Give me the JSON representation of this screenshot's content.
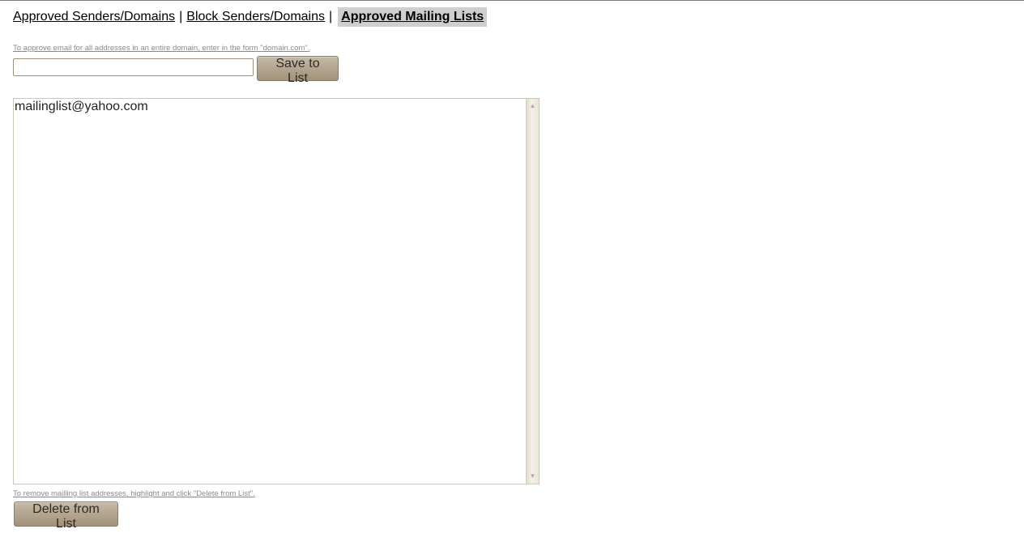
{
  "nav": {
    "approved_senders": "Approved Senders/Domains",
    "separator1": "|",
    "block_senders": "Block Senders/Domains",
    "separator2": "|",
    "approved_mailing_lists": "Approved Mailing Lists"
  },
  "add_section": {
    "hint": "To approve email for all addresses in an entire domain, enter in the form \"domain.com\".",
    "input_value": "",
    "input_placeholder": "",
    "save_label": "Save to List"
  },
  "list": {
    "items": [
      "mailinglist@yahoo.com"
    ]
  },
  "remove_section": {
    "hint": "To remove mailling list addresses, highlight and click \"Delete from List\".",
    "delete_label": "Delete from List"
  },
  "icons": {
    "scroll_up": "triangle-up",
    "scroll_down": "triangle-down"
  },
  "colors": {
    "button_bg": "#b3a58f",
    "active_tab_bg": "#cfcfcf",
    "hint_text": "#8a8a8a"
  }
}
